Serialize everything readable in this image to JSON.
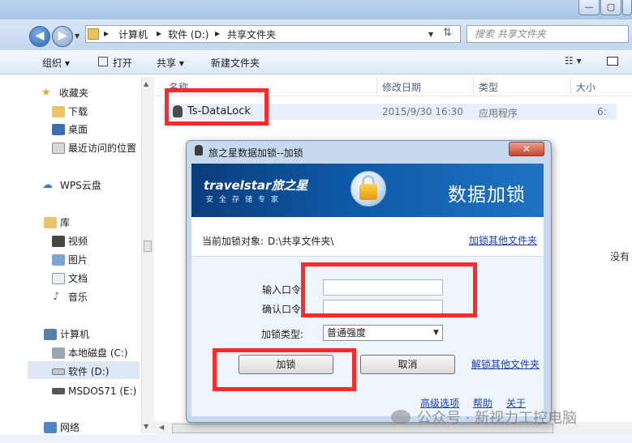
{
  "explorer": {
    "breadcrumb": [
      "计算机",
      "软件 (D:)",
      "共享文件夹"
    ],
    "search_placeholder": "搜索 共享文件夹",
    "toolbar": [
      "组织 ▾",
      "打开",
      "共享 ▾",
      "新建文件夹"
    ],
    "sidebar": {
      "favorites_title": "收藏夹",
      "favorites": [
        "下载",
        "桌面",
        "最近访问的位置"
      ],
      "wps": "WPS云盘",
      "library_title": "库",
      "library": [
        "视频",
        "图片",
        "文档",
        "音乐"
      ],
      "computer_title": "计算机",
      "computer": [
        "本地磁盘 (C:)",
        "软件 (D:)",
        "MSDOS71 (E:)"
      ],
      "network": "网络"
    },
    "columns": [
      "名称",
      "修改日期",
      "类型",
      "大小"
    ],
    "file": {
      "name": "Ts-DataLock",
      "modified": "2015/9/30 16:30",
      "type": "应用程序",
      "size": "6:"
    },
    "side_text": "没有"
  },
  "dialog": {
    "title": "旅之星数据加锁--加锁",
    "brand": "travelstar旅之星",
    "brand_sub": "安全存储专家",
    "heading": "数据加锁",
    "target_label": "当前加锁对象:",
    "target_path": "D:\\共享文件夹\\",
    "lock_other_link": "加锁其他文件夹",
    "password_label": "输入口令",
    "confirm_label": "确认口令",
    "type_label": "加锁类型:",
    "type_value": "普通强度",
    "lock_button": "加锁",
    "cancel_button": "取消",
    "unlock_other_link": "解锁其他文件夹",
    "footer_links": [
      "高级选项",
      "帮助",
      "关于"
    ],
    "close_label": "✕"
  },
  "watermark": "公众号 · 新视力工控电脑"
}
